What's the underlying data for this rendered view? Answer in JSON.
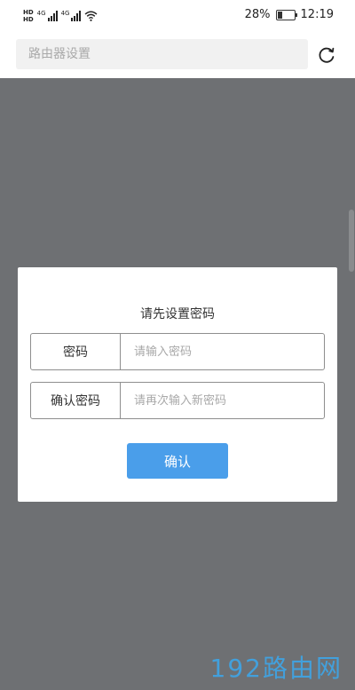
{
  "status_bar": {
    "hd_top": "HD",
    "hd_bottom": "HD",
    "sim1_network": "4G",
    "sim2_network": "4G",
    "battery_percent": "28%",
    "battery_level": 0.28,
    "time": "12:19",
    "icons": [
      "hd-icon",
      "signal-icon",
      "wifi-icon",
      "battery-icon"
    ]
  },
  "header": {
    "address_placeholder": "路由器设置",
    "refresh_icon": "refresh-icon"
  },
  "dialog": {
    "title": "请先设置密码",
    "password_label": "密码",
    "password_placeholder": "请输入密码",
    "confirm_password_label": "确认密码",
    "confirm_password_placeholder": "请再次输入新密码",
    "confirm_button": "确认"
  },
  "watermark": "192路由网",
  "colors": {
    "overlay": "#6e7073",
    "button": "#4a9eea",
    "watermark": "#3ea6e8"
  }
}
